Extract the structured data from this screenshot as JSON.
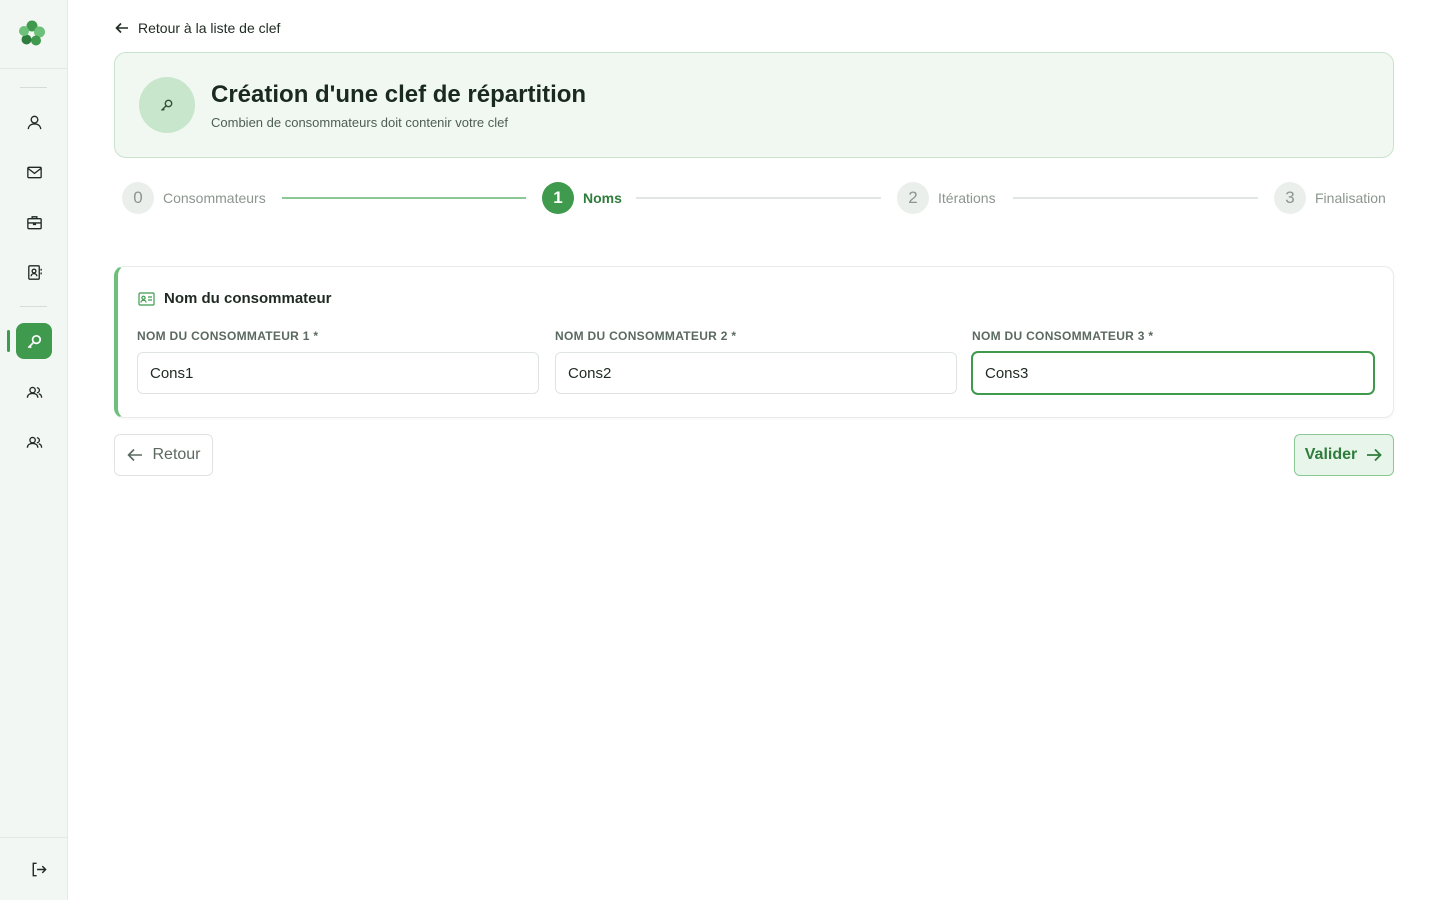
{
  "sidebar": {
    "logo": "clover-logo",
    "items": [
      {
        "icon": "user-icon"
      },
      {
        "icon": "mail-icon"
      },
      {
        "icon": "briefcase-icon"
      },
      {
        "icon": "contact-book-icon"
      },
      {
        "icon": "key-icon",
        "active": true
      },
      {
        "icon": "users-icon"
      },
      {
        "icon": "users-icon"
      }
    ],
    "logout_icon": "logout-icon"
  },
  "back_link": {
    "label": "Retour à la liste de clef"
  },
  "header": {
    "title": "Création d'une clef de répartition",
    "subtitle": "Combien de consommateurs doit contenir votre clef"
  },
  "stepper": {
    "steps": [
      {
        "number": "0",
        "label": "Consommateurs"
      },
      {
        "number": "1",
        "label": "Noms",
        "active": true
      },
      {
        "number": "2",
        "label": "Itérations"
      },
      {
        "number": "3",
        "label": "Finalisation"
      }
    ]
  },
  "form": {
    "title": "Nom du consommateur",
    "fields": [
      {
        "label": "NOM DU CONSOMMATEUR 1 *",
        "value": "Cons1"
      },
      {
        "label": "NOM DU CONSOMMATEUR 2 *",
        "value": "Cons2"
      },
      {
        "label": "NOM DU CONSOMMATEUR 3 *",
        "value": "Cons3"
      }
    ]
  },
  "actions": {
    "back_label": "Retour",
    "next_label": "Valider"
  },
  "colors": {
    "accent": "#3f9a4d",
    "accent_light": "#e8f5ea",
    "header_bg": "#f1f8f2"
  }
}
